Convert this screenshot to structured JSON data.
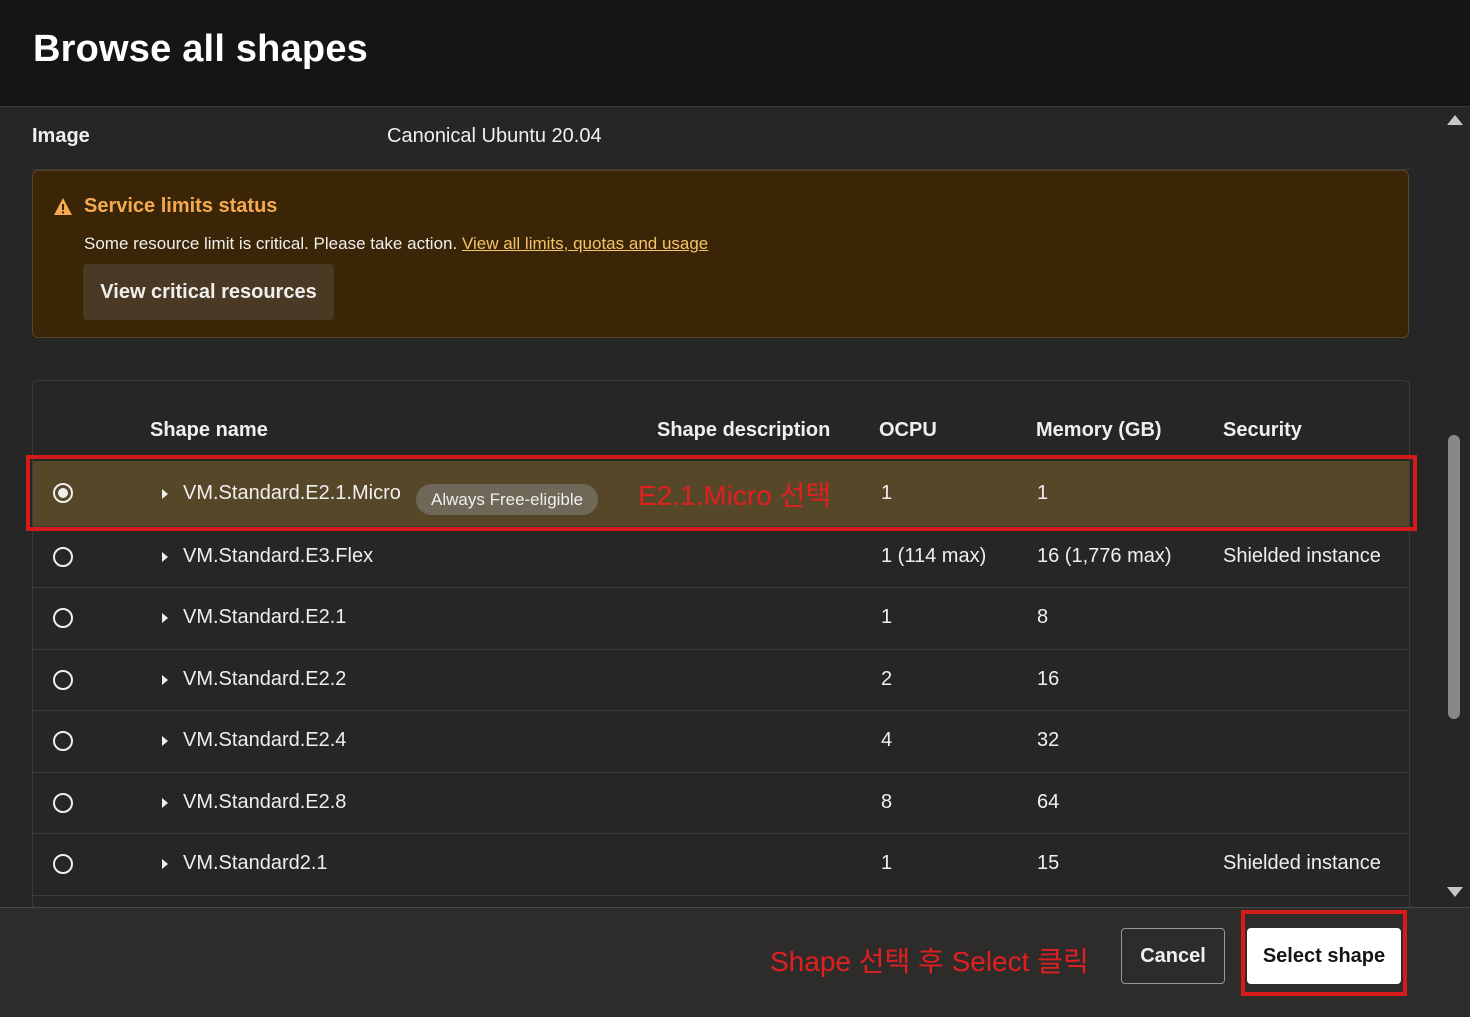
{
  "dialog": {
    "title": "Browse all shapes"
  },
  "image_row": {
    "label": "Image",
    "value": "Canonical Ubuntu 20.04"
  },
  "alert": {
    "title": "Service limits status",
    "message": "Some resource limit is critical. Please take action.",
    "link": "View all limits, quotas and usage",
    "button": "View critical resources",
    "icon": "warning-icon",
    "color": "#f5a952"
  },
  "table": {
    "headers": {
      "name": "Shape name",
      "description": "Shape description",
      "ocpu": "OCPU",
      "memory": "Memory (GB)",
      "security": "Security"
    },
    "rows": [
      {
        "name": "VM.Standard.E2.1.Micro",
        "badge": "Always Free-eligible",
        "ocpu": "1",
        "memory": "1",
        "security": "",
        "selected": true
      },
      {
        "name": "VM.Standard.E3.Flex",
        "ocpu": "1 (114 max)",
        "memory": "16 (1,776 max)",
        "security": "Shielded instance",
        "selected": false
      },
      {
        "name": "VM.Standard.E2.1",
        "ocpu": "1",
        "memory": "8",
        "security": "",
        "selected": false
      },
      {
        "name": "VM.Standard.E2.2",
        "ocpu": "2",
        "memory": "16",
        "security": "",
        "selected": false
      },
      {
        "name": "VM.Standard.E2.4",
        "ocpu": "4",
        "memory": "32",
        "security": "",
        "selected": false
      },
      {
        "name": "VM.Standard.E2.8",
        "ocpu": "8",
        "memory": "64",
        "security": "",
        "selected": false
      },
      {
        "name": "VM.Standard2.1",
        "ocpu": "1",
        "memory": "15",
        "security": "Shielded instance",
        "selected": false
      }
    ]
  },
  "annotations": {
    "row_note": "E2.1.Micro 선택",
    "footer_note": "Shape 선택 후 Select 클릭",
    "color": "#e02020"
  },
  "footer": {
    "cancel": "Cancel",
    "select": "Select shape"
  }
}
